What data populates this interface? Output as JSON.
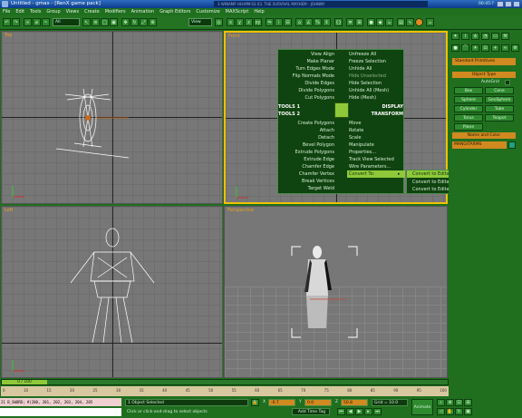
{
  "window": {
    "title": "Untitled - gmax - [RenX game pack]",
    "right_banner": "3 WINAMP  HH:MM:SS  03. THE SURVIVAL MAYHEM - JOHNNY",
    "clock": "00:45:?"
  },
  "menu": [
    "File",
    "Edit",
    "Tools",
    "Group",
    "Views",
    "Create",
    "Modifiers",
    "Animation",
    "Graph Editors",
    "Customize",
    "MAXScript",
    "Help"
  ],
  "toolbar": {
    "selection_filter": "All",
    "reference_coord": "View"
  },
  "viewports": {
    "top": {
      "label": "Top"
    },
    "front": {
      "label": "Front"
    },
    "left": {
      "label": "Left"
    },
    "perspective": {
      "label": "Perspective"
    }
  },
  "quad_menu": {
    "tools1_left": [
      "View Align",
      "Make Planar",
      "Turn Edges Mode",
      "Flip Normals Mode",
      "Divide Edges",
      "Divide Polygons",
      "Cut Polygons"
    ],
    "tools1_header": "TOOLS 1",
    "tools2_header": "TOOLS 2",
    "tools2_left": [
      "Create Polygons",
      "Attach",
      "Detach",
      "Bevel Polygon",
      "Extrude Polygons",
      "Extrude Edge",
      "Chamfer Edge",
      "Chamfer Vertex",
      "Break Vertices",
      "Target Weld"
    ],
    "display_right": [
      "Unfreeze All",
      "Freeze Selection",
      "Unhide All",
      "Hide Unselected",
      "Hide Selection",
      "Unhide All (Mesh)",
      "Hide (Mesh)"
    ],
    "display_header": "DISPLAY",
    "transform_header": "TRANSFORM",
    "transform_right": [
      "Move",
      "Rotate",
      "Scale",
      "Manipulate",
      "Properties...",
      "Track View Selected",
      "Wire Parameters...",
      "Convert To:"
    ]
  },
  "convert_submenu": [
    "Convert to Editable Mesh",
    "Convert to Editable Poly",
    "Convert to Editable Patch"
  ],
  "command_panel": {
    "category": "Standard Primitives",
    "object_type_header": "Object Type",
    "autogrid": "AutoGrid",
    "primitives": [
      "Box",
      "Cone",
      "Sphere",
      "GeoSphere",
      "Cylinder",
      "Tube",
      "Torus",
      "Teapot",
      "Plane"
    ],
    "name_color_header": "Name and Color",
    "object_name": "MANGITARMS",
    "accent_color": "#d08a20",
    "name_swatch": "#20a080"
  },
  "timeline": {
    "frame_readout": "0 / 100",
    "ticks": [
      "0",
      "10",
      "15",
      "20",
      "25",
      "30",
      "35",
      "40",
      "45",
      "50",
      "55",
      "60",
      "65",
      "70",
      "75",
      "80",
      "85",
      "90",
      "95",
      "100"
    ]
  },
  "status": {
    "script_line": "21 B_SWORD; #(200, 201, 202, 203, 204, 205",
    "selection_info": "1 Object Selected",
    "prompt": "Click or click-and-drag to select objects",
    "x": "-0.7",
    "y": "0.0",
    "z": "50.8",
    "grid": "Grid = 10.0",
    "add_time_tag": "Add Time Tag",
    "animate": "Animate"
  }
}
